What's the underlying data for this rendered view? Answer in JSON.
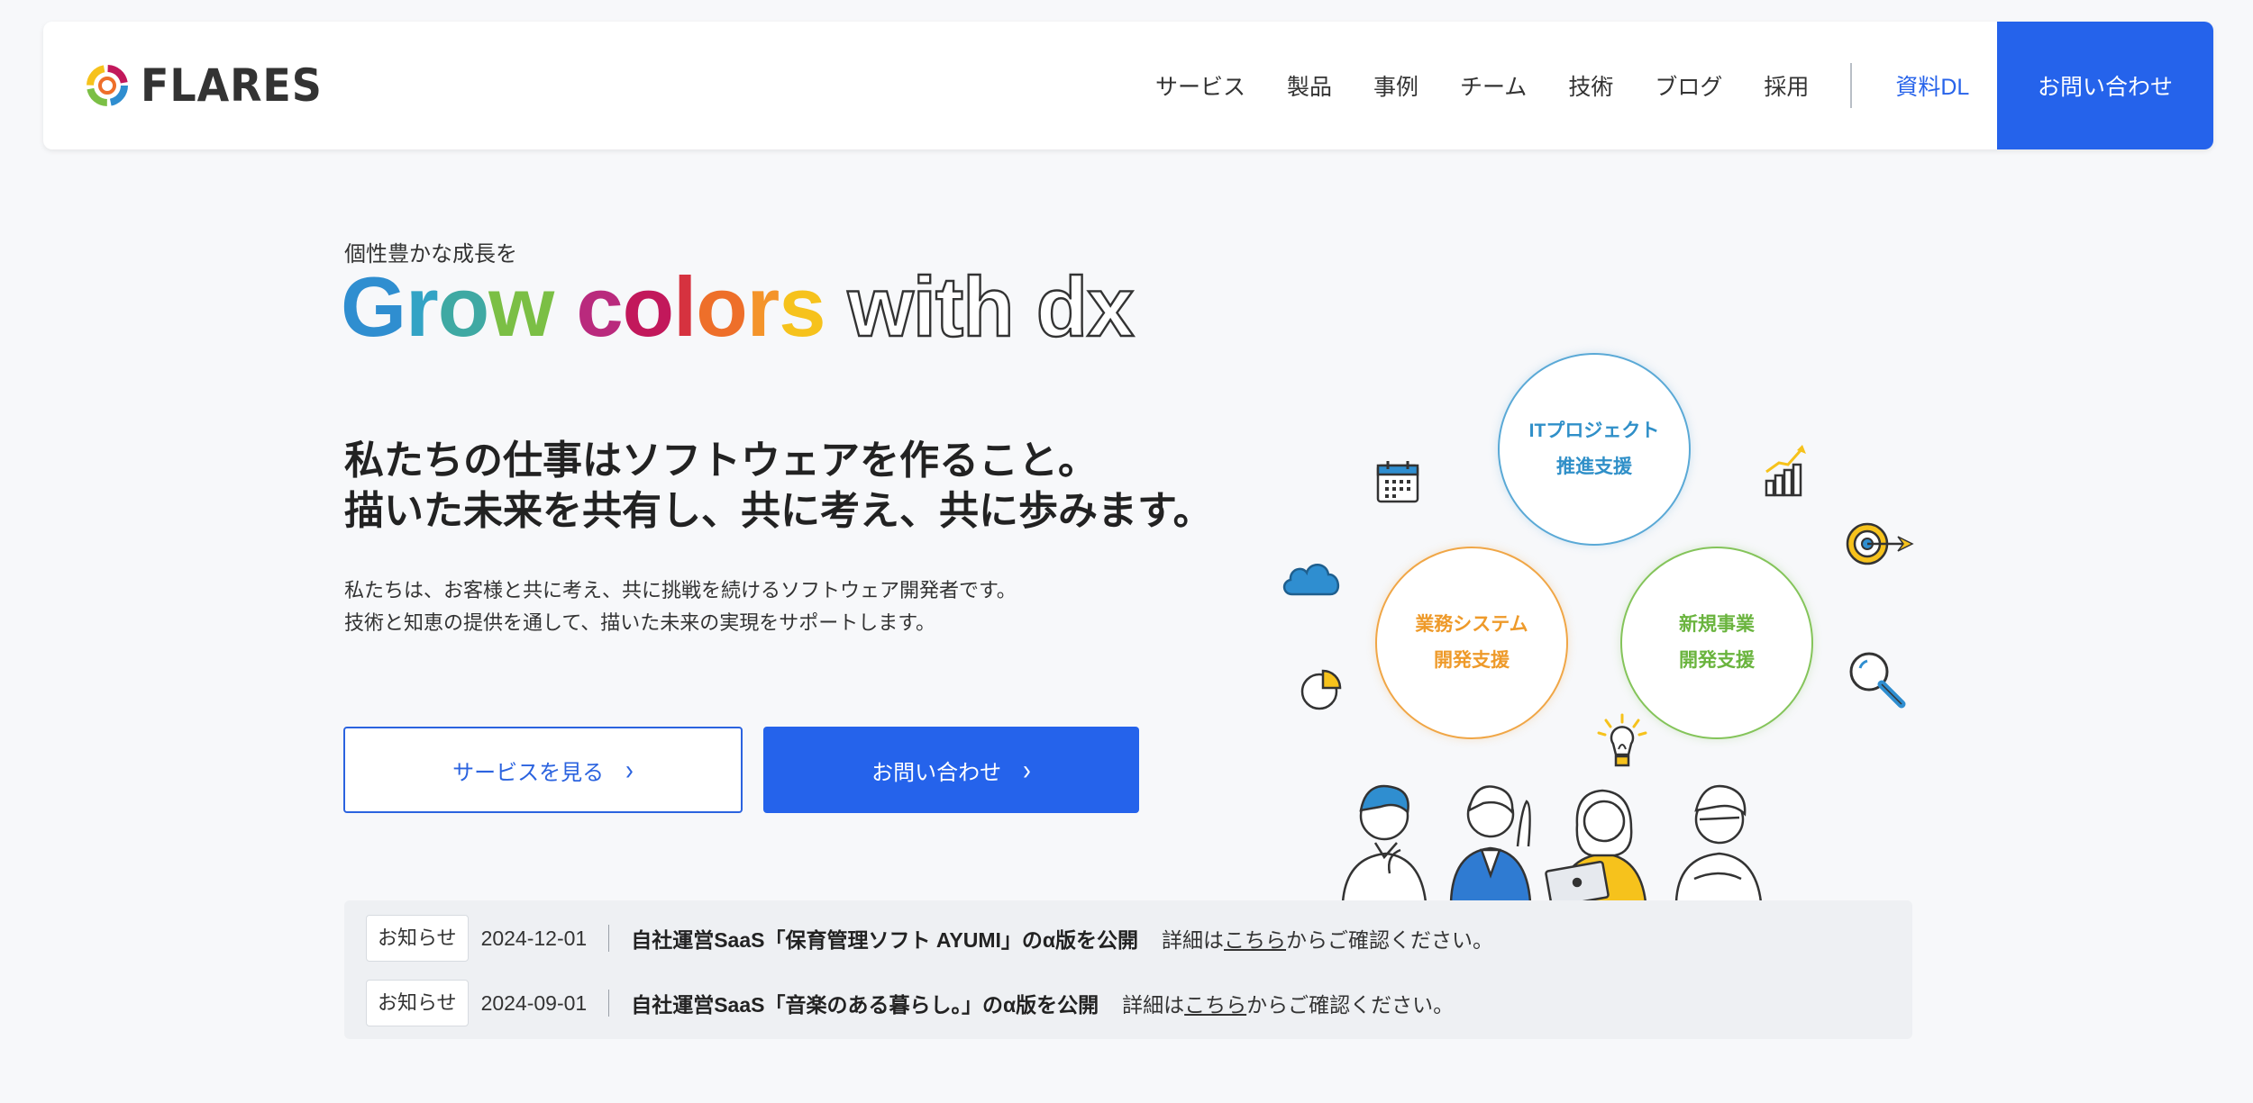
{
  "header": {
    "logo_text": "FLARES",
    "nav": [
      "サービス",
      "製品",
      "事例",
      "チーム",
      "技術",
      "ブログ",
      "採用"
    ],
    "download_label": "資料DL",
    "contact_label": "お問い合わせ"
  },
  "hero": {
    "subtitle": "個性豊かな成長を",
    "title_chars": [
      {
        "char": "G",
        "color": "#2f8ed0"
      },
      {
        "char": "r",
        "color": "#33a3c5"
      },
      {
        "char": "o",
        "color": "#3fa9a3"
      },
      {
        "char": "w",
        "color": "#7bbf45"
      },
      {
        "char": " ",
        "color": "#222222"
      },
      {
        "char": "c",
        "color": "#b92a7d"
      },
      {
        "char": "o",
        "color": "#c2185b"
      },
      {
        "char": "l",
        "color": "#d6323f"
      },
      {
        "char": "o",
        "color": "#ee6f2a"
      },
      {
        "char": "r",
        "color": "#f4942a"
      },
      {
        "char": "s",
        "color": "#f6c21c"
      }
    ],
    "title_outline": "with dx",
    "headline_line1": "私たちの仕事はソフトウェアを作ること。",
    "headline_line2": "描いた未来を共有し、共に考え、共に歩みます。",
    "desc_line1": "私たちは、お客様と共に考え、共に挑戦を続けるソフトウェア開発者です。",
    "desc_line2": "技術と知恵の提供を通して、描いた未来の実現をサポートします。",
    "btn_services": "サービスを見る",
    "btn_contact": "お問い合わせ"
  },
  "illustration": {
    "circle_it_line1": "ITプロジェクト",
    "circle_it_line2": "推進支援",
    "circle_biz_line1": "業務システム",
    "circle_biz_line2": "開発支援",
    "circle_new_line1": "新規事業",
    "circle_new_line2": "開発支援",
    "icons": [
      "calendar-icon",
      "cloud-icon",
      "pie-chart-icon",
      "growth-chart-icon",
      "target-icon",
      "magnifier-icon",
      "lightbulb-icon"
    ]
  },
  "news": [
    {
      "badge": "お知らせ",
      "date": "2024-12-01",
      "title": "自社運営SaaS「保育管理ソフト AYUMI」のα版を公開",
      "detail_prefix": "詳細は",
      "link": "こちら",
      "detail_suffix": "からご確認ください。"
    },
    {
      "badge": "お知らせ",
      "date": "2024-09-01",
      "title": "自社運営SaaS「音楽のある暮らし。」のα版を公開",
      "detail_prefix": "詳細は",
      "link": "こちら",
      "detail_suffix": "からご確認ください。"
    }
  ],
  "colors": {
    "accent": "#2563eb",
    "background": "#f7f8fa"
  }
}
